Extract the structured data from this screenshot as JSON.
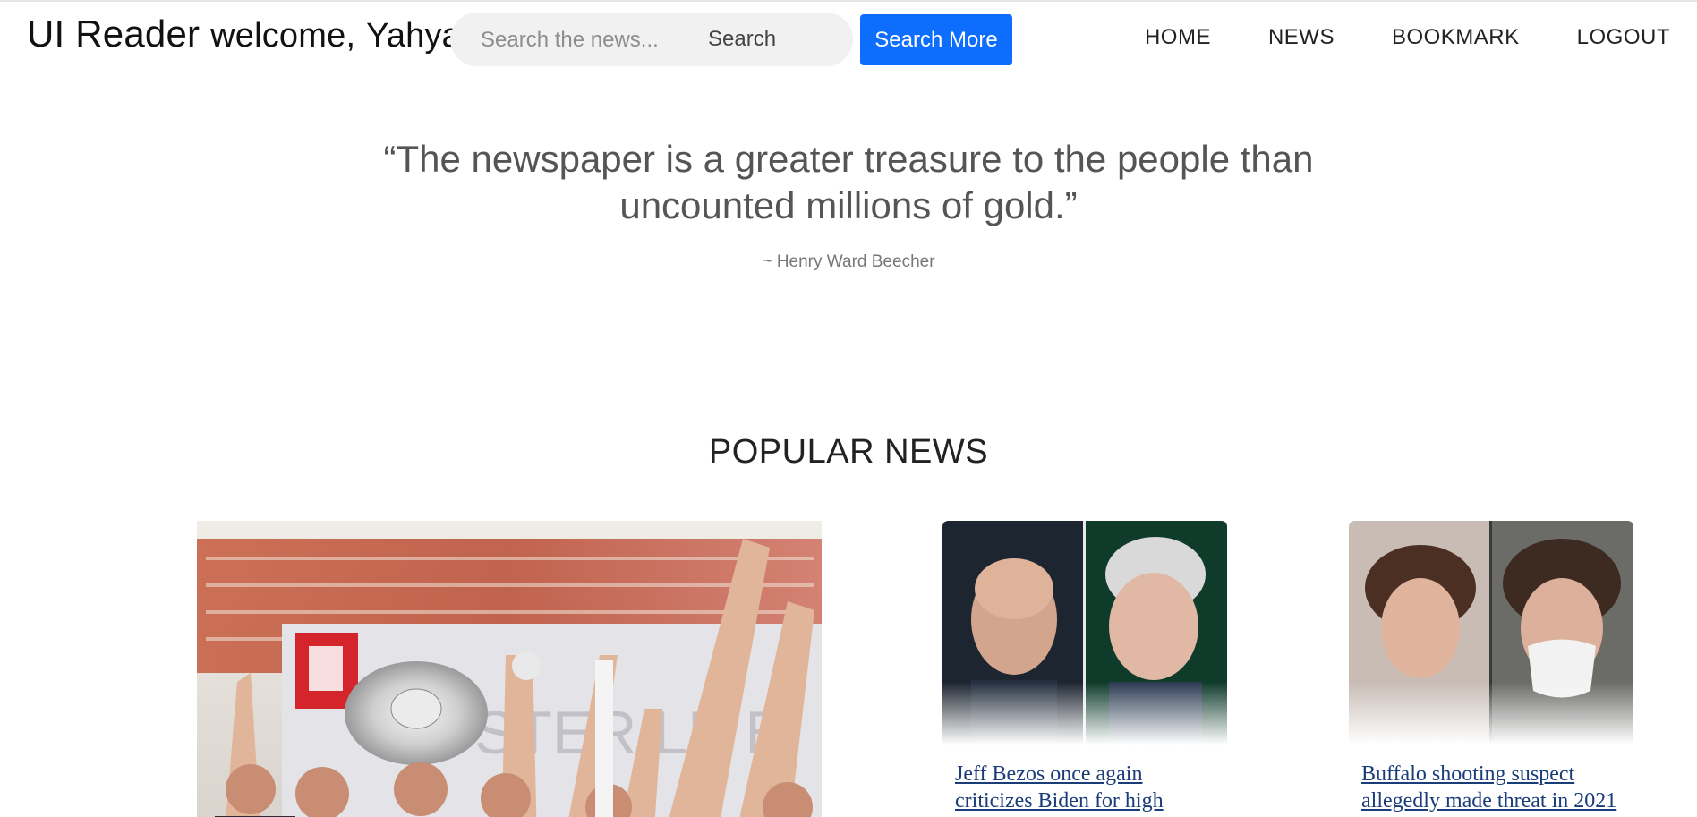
{
  "header": {
    "brand": "UI Reader",
    "welcome": "welcome,",
    "username": "Yahya",
    "search": {
      "placeholder": "Search the news...",
      "button": "Search",
      "more_button": "Search More"
    },
    "nav": [
      "HOME",
      "NEWS",
      "BOOKMARK",
      "LOGOUT"
    ]
  },
  "quote": {
    "text": "“The newspaper is a greater treasure to the people than uncounted millions of gold.”",
    "author": "~ Henry Ward Beecher"
  },
  "popular": {
    "title": "POPULAR NEWS",
    "cards": [
      {
        "title": "Jeff Bezos once again criticizes Biden for high inflation"
      },
      {
        "title": "Buffalo shooting suspect allegedly made threat in 2021"
      }
    ]
  },
  "colors": {
    "accent": "#0d6efd",
    "link": "#1a3d7a"
  }
}
